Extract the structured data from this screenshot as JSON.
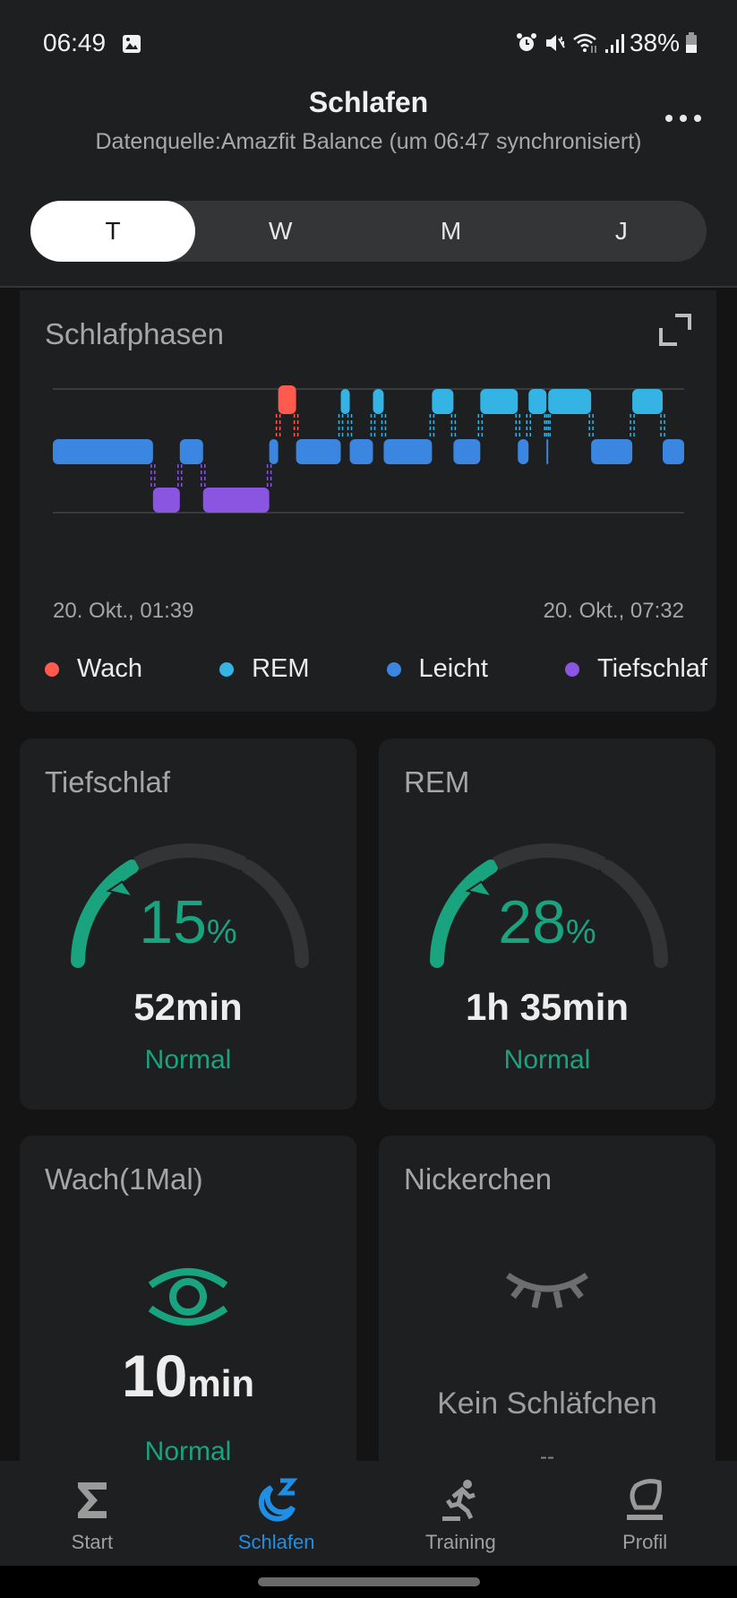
{
  "status_bar": {
    "time": "06:49",
    "battery": "38%",
    "icons": [
      "gallery-icon",
      "alarm-icon",
      "mute-icon",
      "wifi-icon",
      "signal-icon",
      "battery-icon"
    ]
  },
  "header": {
    "title": "Schlafen",
    "subtitle": "Datenquelle:Amazfit Balance (um 06:47 synchronisiert)",
    "more_icon": "more-horizontal-icon"
  },
  "period_tabs": [
    {
      "label": "T",
      "active": true
    },
    {
      "label": "W",
      "active": false
    },
    {
      "label": "M",
      "active": false
    },
    {
      "label": "J",
      "active": false
    }
  ],
  "phases_card": {
    "title": "Schlafphasen",
    "expand_icon": "expand-icon",
    "start_label": "20. Okt., 01:39",
    "end_label": "20. Okt., 07:32"
  },
  "chart_data": {
    "type": "hypnogram",
    "title": "Schlafphasen",
    "start": "01:39",
    "end": "07:32",
    "stage_levels": [
      "Wach",
      "REM",
      "Leicht",
      "Tiefschlaf"
    ],
    "colors": {
      "Wach": "#ff5a4e",
      "REM": "#34b4e4",
      "Leicht": "#3a86e0",
      "Tiefschlaf": "#8a55e0"
    },
    "legend": [
      "Wach",
      "REM",
      "Leicht",
      "Tiefschlaf"
    ],
    "segments_minutes": [
      {
        "stage": "Leicht",
        "start": 0,
        "end": 56
      },
      {
        "stage": "Tiefschlaf",
        "start": 56,
        "end": 71
      },
      {
        "stage": "Leicht",
        "start": 71,
        "end": 84
      },
      {
        "stage": "Tiefschlaf",
        "start": 84,
        "end": 121
      },
      {
        "stage": "Leicht",
        "start": 121,
        "end": 126
      },
      {
        "stage": "Wach",
        "start": 126,
        "end": 136
      },
      {
        "stage": "Leicht",
        "start": 136,
        "end": 161
      },
      {
        "stage": "REM",
        "start": 161,
        "end": 166
      },
      {
        "stage": "Leicht",
        "start": 166,
        "end": 179
      },
      {
        "stage": "REM",
        "start": 179,
        "end": 185
      },
      {
        "stage": "Leicht",
        "start": 185,
        "end": 212
      },
      {
        "stage": "REM",
        "start": 212,
        "end": 224
      },
      {
        "stage": "Leicht",
        "start": 224,
        "end": 239
      },
      {
        "stage": "REM",
        "start": 239,
        "end": 260
      },
      {
        "stage": "Leicht",
        "start": 260,
        "end": 266
      },
      {
        "stage": "REM",
        "start": 266,
        "end": 276
      },
      {
        "stage": "Leicht",
        "start": 276,
        "end": 277
      },
      {
        "stage": "REM",
        "start": 277,
        "end": 301
      },
      {
        "stage": "Leicht",
        "start": 301,
        "end": 324
      },
      {
        "stage": "REM",
        "start": 324,
        "end": 341
      },
      {
        "stage": "Leicht",
        "start": 341,
        "end": 353
      }
    ],
    "total_minutes": 353
  },
  "deep_card": {
    "title": "Tiefschlaf",
    "percent": "15",
    "percent_unit": "%",
    "duration": "52min",
    "rating": "Normal",
    "gauge_fraction": 0.33,
    "pointer_fraction": 0.24
  },
  "rem_card": {
    "title": "REM",
    "percent": "28",
    "percent_unit": "%",
    "duration": "1h 35min",
    "rating": "Normal",
    "gauge_fraction": 0.33,
    "pointer_fraction": 0.24
  },
  "wake_card": {
    "title": "Wach(1Mal)",
    "value": "10",
    "unit": "min",
    "rating": "Normal",
    "icon": "eye-icon"
  },
  "nap_card": {
    "title": "Nickerchen",
    "text": "Kein Schläfchen",
    "value": "--",
    "icon": "closed-eye-icon"
  },
  "bottom_nav": [
    {
      "label": "Start",
      "icon": "sigma-icon",
      "active": false
    },
    {
      "label": "Schlafen",
      "icon": "sleep-moon-icon",
      "active": true
    },
    {
      "label": "Training",
      "icon": "runner-icon",
      "active": false
    },
    {
      "label": "Profil",
      "icon": "profile-icon",
      "active": false
    }
  ],
  "accent": "#1aa37f",
  "nav_active_color": "#1f8fe5"
}
